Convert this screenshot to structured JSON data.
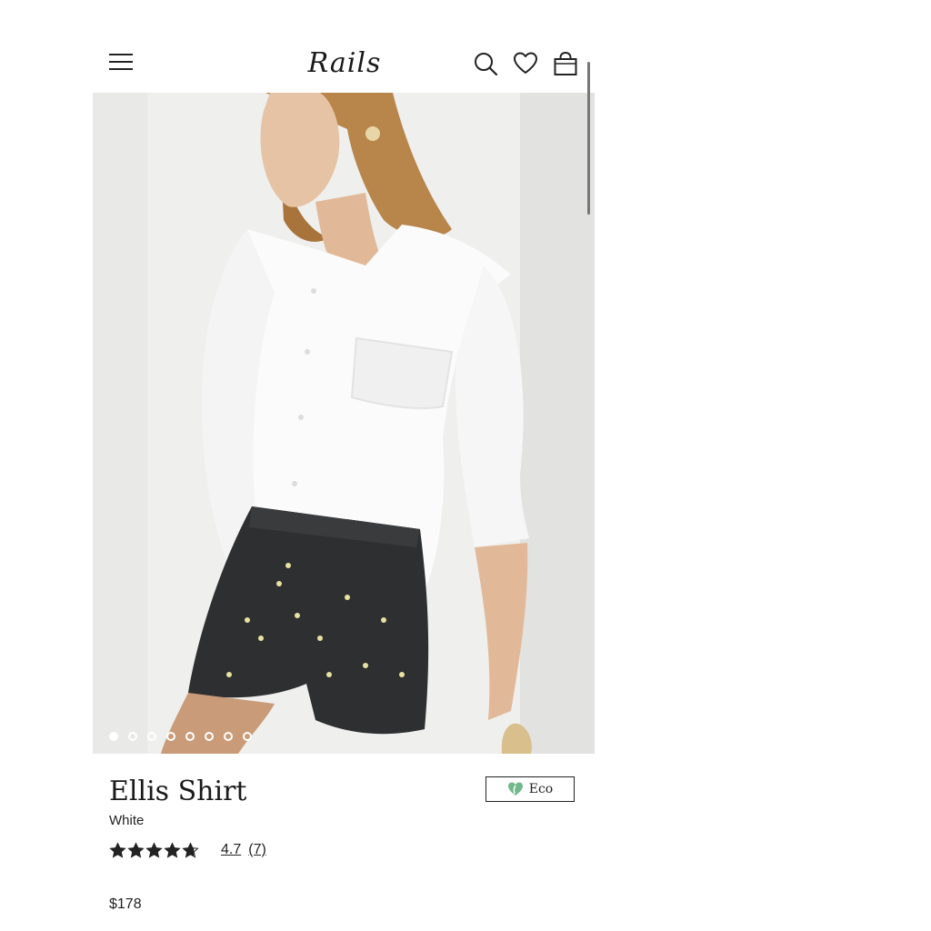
{
  "header": {
    "logo_text": "Rails",
    "menu_icon": "hamburger-menu-icon",
    "search_icon": "search-icon",
    "wishlist_icon": "heart-icon",
    "bag_icon": "shopping-bag-icon"
  },
  "gallery": {
    "image_count": 8,
    "active_index": 0
  },
  "product": {
    "title": "Ellis Shirt",
    "color": "White",
    "rating_value": "4.7",
    "rating_count": "(7)",
    "stars": 4.7,
    "badge_label": "Eco",
    "badge_icon": "eco-heart-icon",
    "price": "$178"
  },
  "colors": {
    "accent_green": "#6fb98a",
    "text": "#1a1a1a"
  }
}
